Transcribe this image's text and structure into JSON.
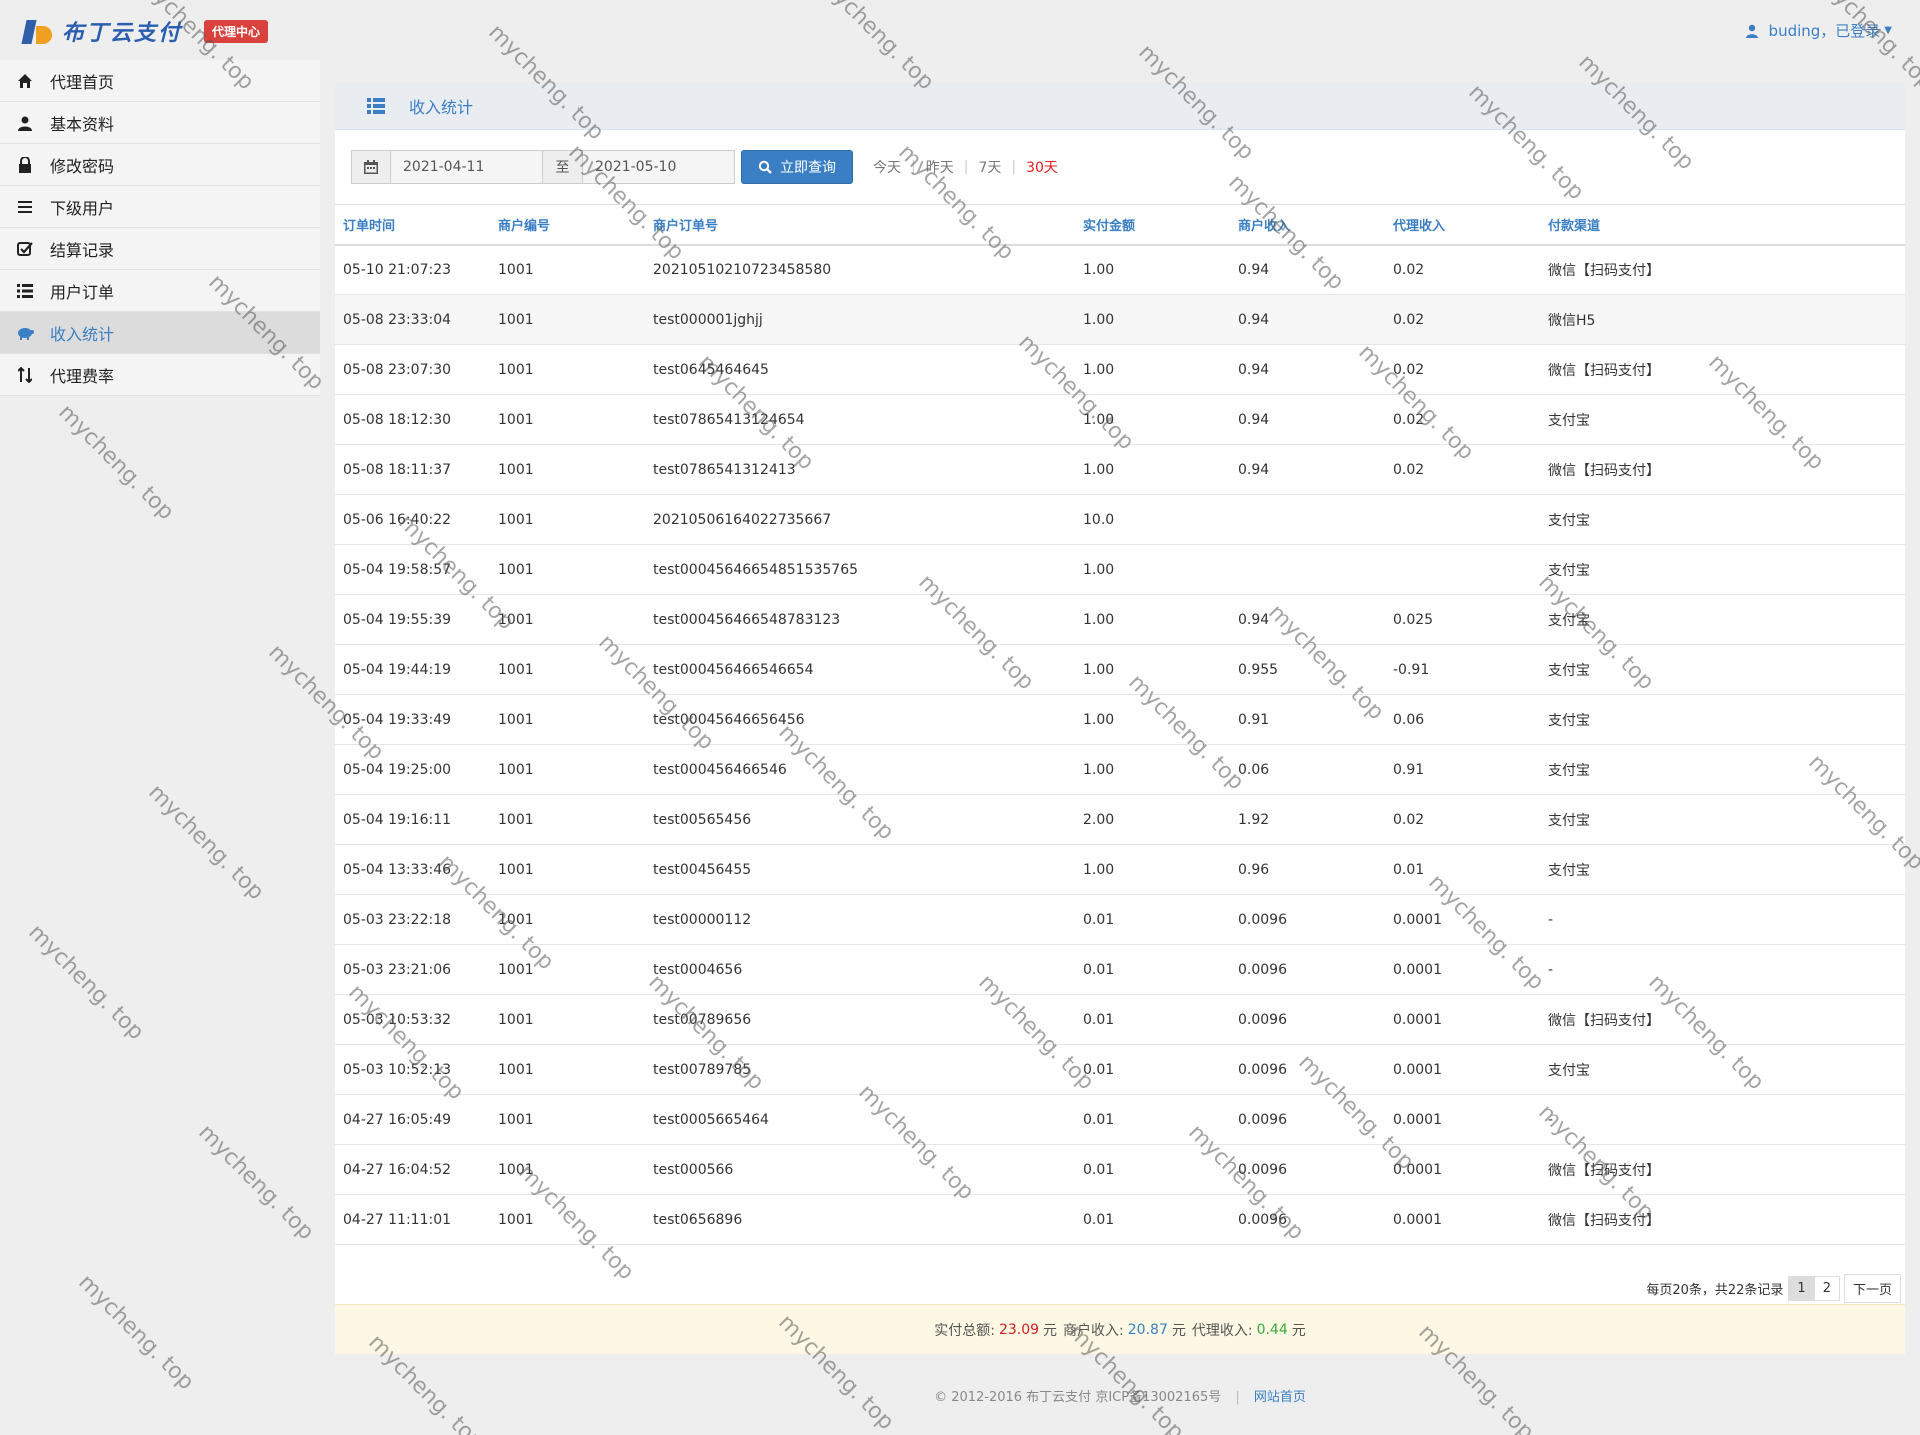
{
  "header": {
    "brand": "布丁云支付",
    "badge": "代理中心",
    "user_label": "buding，已登录"
  },
  "sidebar": {
    "items": [
      {
        "label": "代理首页",
        "icon": "home-icon"
      },
      {
        "label": "基本资料",
        "icon": "user-icon"
      },
      {
        "label": "修改密码",
        "icon": "lock-icon"
      },
      {
        "label": "下级用户",
        "icon": "menu-icon"
      },
      {
        "label": "结算记录",
        "icon": "check-square-icon"
      },
      {
        "label": "用户订单",
        "icon": "list-icon"
      },
      {
        "label": "收入统计",
        "icon": "piggy-bank-icon"
      },
      {
        "label": "代理费率",
        "icon": "sort-icon"
      }
    ],
    "active_index": 6
  },
  "panel": {
    "title": "收入统计"
  },
  "filter": {
    "start_date": "2021-04-11",
    "to_label": "至",
    "end_date": "2021-05-10",
    "query_label": "立即查询",
    "quick": [
      "今天",
      "昨天",
      "7天",
      "30天"
    ],
    "quick_active": "30天"
  },
  "table": {
    "columns": [
      "订单时间",
      "商户编号",
      "商户订单号",
      "实付金额",
      "商户收入",
      "代理收入",
      "付款渠道"
    ],
    "rows": [
      [
        "05-10 21:07:23",
        "1001",
        "20210510210723458580",
        "1.00",
        "0.94",
        "0.02",
        "微信【扫码支付】"
      ],
      [
        "05-08 23:33:04",
        "1001",
        "test000001jghjj",
        "1.00",
        "0.94",
        "0.02",
        "微信H5"
      ],
      [
        "05-08 23:07:30",
        "1001",
        "test0645464645",
        "1.00",
        "0.94",
        "0.02",
        "微信【扫码支付】"
      ],
      [
        "05-08 18:12:30",
        "1001",
        "test07865413124654",
        "1.00",
        "0.94",
        "0.02",
        "支付宝"
      ],
      [
        "05-08 18:11:37",
        "1001",
        "test0786541312413",
        "1.00",
        "0.94",
        "0.02",
        "微信【扫码支付】"
      ],
      [
        "05-06 16:40:22",
        "1001",
        "20210506164022735667",
        "10.0",
        "",
        "",
        "支付宝"
      ],
      [
        "05-04 19:58:57",
        "1001",
        "test00045646654851535765",
        "1.00",
        "",
        "",
        "支付宝"
      ],
      [
        "05-04 19:55:39",
        "1001",
        "test000456466548783123",
        "1.00",
        "0.94",
        "0.025",
        "支付宝"
      ],
      [
        "05-04 19:44:19",
        "1001",
        "test000456466546654",
        "1.00",
        "0.955",
        "-0.91",
        "支付宝"
      ],
      [
        "05-04 19:33:49",
        "1001",
        "test00045646656456",
        "1.00",
        "0.91",
        "0.06",
        "支付宝"
      ],
      [
        "05-04 19:25:00",
        "1001",
        "test000456466546",
        "1.00",
        "0.06",
        "0.91",
        "支付宝"
      ],
      [
        "05-04 19:16:11",
        "1001",
        "test00565456",
        "2.00",
        "1.92",
        "0.02",
        "支付宝"
      ],
      [
        "05-04 13:33:46",
        "1001",
        "test00456455",
        "1.00",
        "0.96",
        "0.01",
        "支付宝"
      ],
      [
        "05-03 23:22:18",
        "1001",
        "test00000112",
        "0.01",
        "0.0096",
        "0.0001",
        "-"
      ],
      [
        "05-03 23:21:06",
        "1001",
        "test0004656",
        "0.01",
        "0.0096",
        "0.0001",
        "-"
      ],
      [
        "05-03 10:53:32",
        "1001",
        "test00789656",
        "0.01",
        "0.0096",
        "0.0001",
        "微信【扫码支付】"
      ],
      [
        "05-03 10:52:13",
        "1001",
        "test00789785",
        "0.01",
        "0.0096",
        "0.0001",
        "支付宝"
      ],
      [
        "04-27 16:05:49",
        "1001",
        "test0005665464",
        "0.01",
        "0.0096",
        "0.0001",
        "-"
      ],
      [
        "04-27 16:04:52",
        "1001",
        "test000566",
        "0.01",
        "0.0096",
        "0.0001",
        "微信【扫码支付】"
      ],
      [
        "04-27 11:11:01",
        "1001",
        "test0656896",
        "0.01",
        "0.0096",
        "0.0001",
        "微信【扫码支付】"
      ]
    ]
  },
  "pager": {
    "info": "每页20条，共22条记录",
    "pages": [
      "1",
      "2"
    ],
    "current": "1",
    "next": "下一页"
  },
  "summary": {
    "total_label": "实付总额:",
    "total_value": "23.09",
    "unit": "元",
    "merchant_label": "商户收入:",
    "merchant_value": "20.87",
    "agent_label": "代理收入:",
    "agent_value": "0.44"
  },
  "footer": {
    "copyright": "© 2012-2016 布丁云支付 京ICP备13002165号",
    "home_link": "网站首页"
  },
  "watermark": "mycheng. top",
  "colors": {
    "accent": "#3a7fc4",
    "amount": "#d02020",
    "agent": "#3cab3c",
    "badge": "#d9413c"
  }
}
